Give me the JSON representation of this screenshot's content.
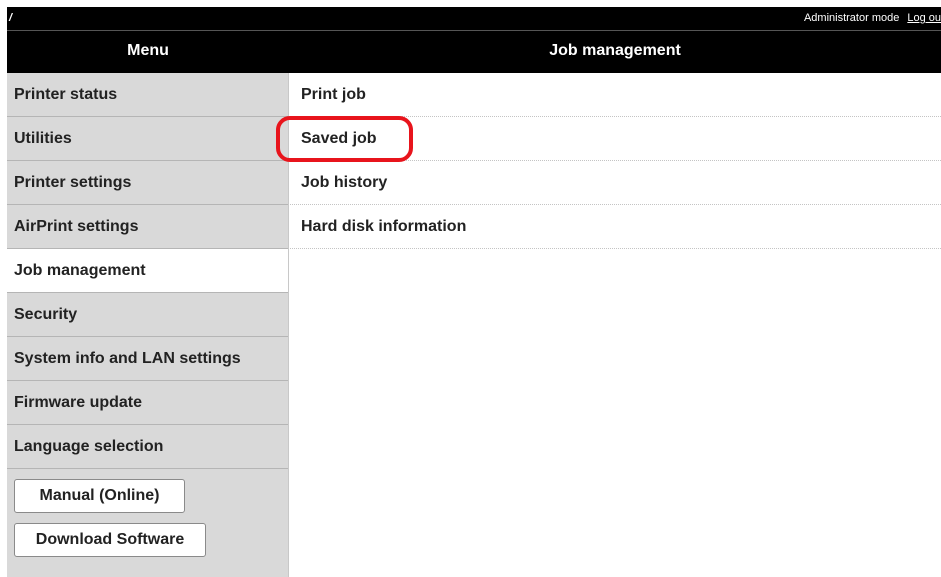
{
  "topbar": {
    "crumb": "/",
    "mode": "Administrator mode",
    "logout": "Log ou"
  },
  "header": {
    "menu_title": "Menu",
    "page_title": "Job management"
  },
  "sidebar": {
    "items": [
      {
        "label": "Printer status"
      },
      {
        "label": "Utilities"
      },
      {
        "label": "Printer settings"
      },
      {
        "label": "AirPrint settings"
      },
      {
        "label": "Job management",
        "active": true
      },
      {
        "label": "Security"
      },
      {
        "label": "System info and LAN settings"
      },
      {
        "label": "Firmware update"
      },
      {
        "label": "Language selection"
      }
    ],
    "manual_button": "Manual (Online)",
    "download_button": "Download Software"
  },
  "content": {
    "items": [
      {
        "label": "Print job"
      },
      {
        "label": "Saved job"
      },
      {
        "label": "Job history"
      },
      {
        "label": "Hard disk information"
      }
    ]
  },
  "colors": {
    "header_bg": "#000000",
    "sidebar_bg": "#d9d9d9",
    "highlight": "#e8141c"
  }
}
